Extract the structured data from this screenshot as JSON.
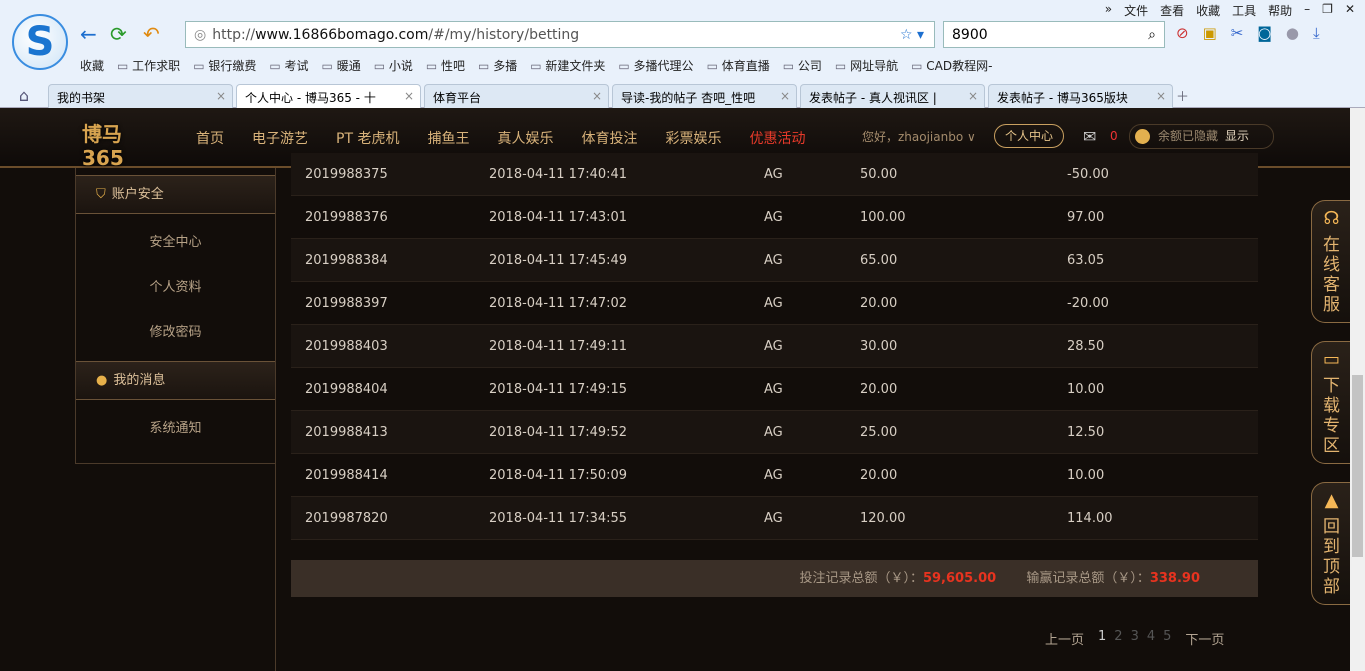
{
  "browser": {
    "menu": [
      "»",
      "文件",
      "查看",
      "收藏",
      "工具",
      "帮助"
    ],
    "url_prefix": "http://",
    "url_host": "www.16866bomago.com",
    "url_path": "/#/my/history/betting",
    "search_value": "8900",
    "bookmarks_label": "收藏",
    "bookmarks": [
      "工作求职",
      "银行缴费",
      "考试",
      "暖通",
      "小说",
      "性吧",
      "多播",
      "新建文件夹",
      "多播代理公",
      "体育直播",
      "公司",
      "网址导航",
      "CAD教程网-"
    ],
    "tabs": [
      "我的书架",
      "个人中心 - 博马365 - 十",
      "体育平台",
      "导读-我的帖子 杏吧_性吧",
      "发表帖子 - 真人视讯区 |",
      "发表帖子 - 博马365版块"
    ]
  },
  "site": {
    "logo": "博马365",
    "nav": [
      "首页",
      "电子游艺",
      "PT 老虎机",
      "捕鱼王",
      "真人娱乐",
      "体育投注",
      "彩票娱乐"
    ],
    "promo": "优惠活动",
    "greeting": "您好，zhaojianbo",
    "personal_center": "个人中心",
    "mail_count": "0",
    "balance_hidden": "余额已隐藏",
    "show": "显示"
  },
  "sidebar": {
    "section1": "账户安全",
    "items1": [
      "安全中心",
      "个人资料",
      "修改密码"
    ],
    "section2": "我的消息",
    "items2": [
      "系统通知"
    ]
  },
  "records": [
    [
      "2019988375",
      "2018-04-11 17:40:41",
      "AG",
      "50.00",
      "-50.00"
    ],
    [
      "2019988376",
      "2018-04-11 17:43:01",
      "AG",
      "100.00",
      "97.00"
    ],
    [
      "2019988384",
      "2018-04-11 17:45:49",
      "AG",
      "65.00",
      "63.05"
    ],
    [
      "2019988397",
      "2018-04-11 17:47:02",
      "AG",
      "20.00",
      "-20.00"
    ],
    [
      "2019988403",
      "2018-04-11 17:49:11",
      "AG",
      "30.00",
      "28.50"
    ],
    [
      "2019988404",
      "2018-04-11 17:49:15",
      "AG",
      "20.00",
      "10.00"
    ],
    [
      "2019988413",
      "2018-04-11 17:49:52",
      "AG",
      "25.00",
      "12.50"
    ],
    [
      "2019988414",
      "2018-04-11 17:50:09",
      "AG",
      "20.00",
      "10.00"
    ],
    [
      "2019987820",
      "2018-04-11 17:34:55",
      "AG",
      "120.00",
      "114.00"
    ]
  ],
  "summary": {
    "bet_label": "投注记录总额（￥）：",
    "bet_total": "59,605.00",
    "win_label": "输赢记录总额（￥）：",
    "win_total": "338.90"
  },
  "pager": {
    "prev": "上一页",
    "pages": [
      "1",
      "2",
      "3",
      "4",
      "5"
    ],
    "next": "下一页"
  },
  "float": {
    "service": "在线客服",
    "download": "下载专区",
    "top": "回到顶部"
  }
}
